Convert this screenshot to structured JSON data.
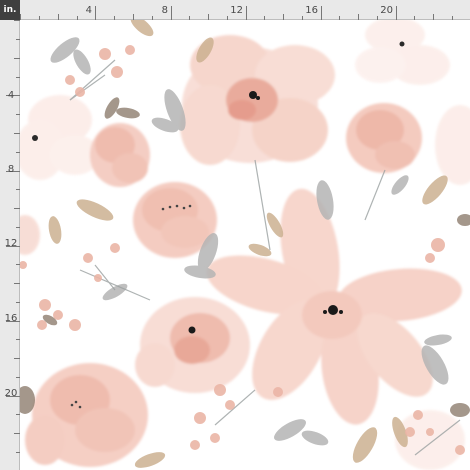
{
  "ruler": {
    "unit": "in.",
    "top_labels": [
      "4",
      "8",
      "12",
      "16",
      "20"
    ],
    "left_labels": [
      "4",
      "8",
      "12",
      "16",
      "20"
    ]
  },
  "pattern": {
    "description_icon": "watercolor-floral-icon",
    "colors": {
      "background": "#ffffff",
      "petal_light": "#fbe6e0",
      "petal_mid": "#f4cfc4",
      "petal_deep": "#e9a99a",
      "center": "#1a1a1a",
      "leaf_gray": "#a7a7a7",
      "leaf_tan": "#cdb38f",
      "leaf_brown": "#8c7a6b",
      "ruler_bg": "#e9e9e9",
      "corner_bg": "#3f3f3f"
    }
  }
}
